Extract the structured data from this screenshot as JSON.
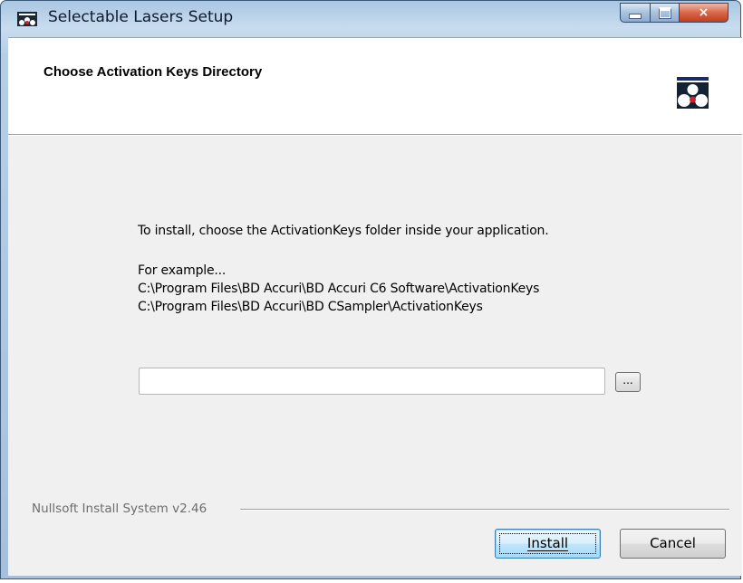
{
  "window": {
    "title": "Selectable Lasers Setup",
    "app_icon": "nsis-app-icon",
    "controls": {
      "minimize": "minimize-icon",
      "maximize": "maximize-icon",
      "close": "×"
    }
  },
  "header": {
    "title": "Choose Activation Keys Directory",
    "logo": "laser-logo-icon"
  },
  "content": {
    "instruction": "To install, choose the ActivationKeys folder inside your application.",
    "example_label": "For example...",
    "example_path_1": "C:\\Program Files\\BD Accuri\\BD Accuri C6 Software\\ActivationKeys",
    "example_path_2": "C:\\Program Files\\BD Accuri\\BD CSampler\\ActivationKeys"
  },
  "directory": {
    "value": "",
    "browse_label": "..."
  },
  "footer": {
    "branding": "Nullsoft Install System v2.46",
    "install_label": "Install",
    "cancel_label": "Cancel"
  },
  "colors": {
    "frame_accent": "#a9c6e3",
    "close_button": "#c23e1e",
    "focus_button": "#3c7fb1"
  }
}
